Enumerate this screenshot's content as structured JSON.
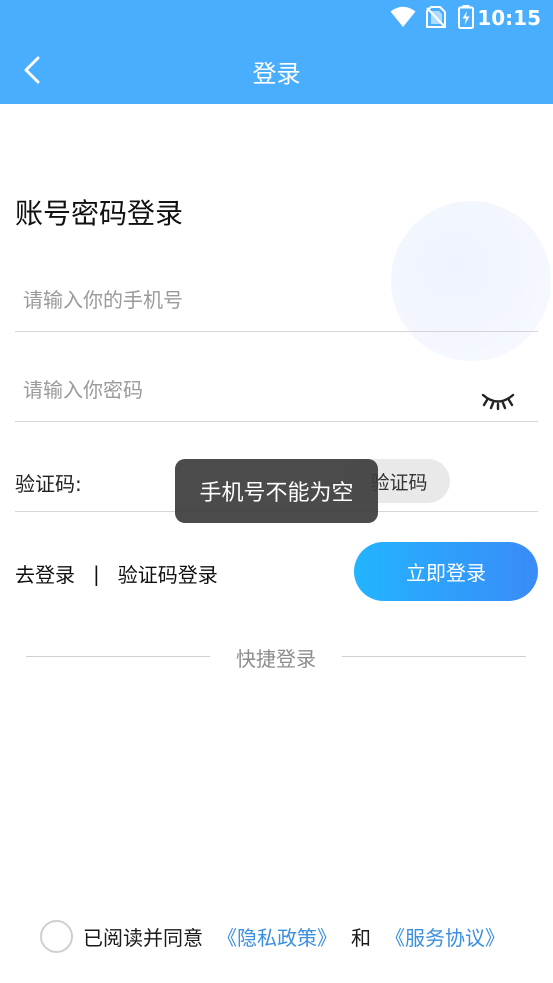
{
  "status_bar": {
    "time": "10:15",
    "icons": [
      "wifi-icon",
      "no-sim-icon",
      "battery-charging-icon"
    ]
  },
  "app_bar": {
    "title": "登录",
    "back_icon": "chevron-left-icon"
  },
  "form": {
    "heading": "账号密码登录",
    "phone": {
      "placeholder": "请输入你的手机号",
      "value": ""
    },
    "password": {
      "placeholder": "请输入你密码",
      "value": "",
      "toggle_icon": "eye-closed-icon"
    },
    "code": {
      "label": "验证码:",
      "value": "",
      "button_label": "验证码"
    }
  },
  "links": {
    "login": "去登录",
    "separator": "|",
    "code_login": "验证码登录"
  },
  "submit_label": "立即登录",
  "quick_login_label": "快捷登录",
  "agreement": {
    "text": "已阅读并同意",
    "privacy": "《隐私政策》",
    "and": "和",
    "service": "《服务协议》",
    "checked": false
  },
  "toast": "手机号不能为空",
  "colors": {
    "primary": "#4aaeff",
    "button_start": "#23b4ff",
    "button_end": "#3a8bf7",
    "link": "#3a8fe0"
  }
}
